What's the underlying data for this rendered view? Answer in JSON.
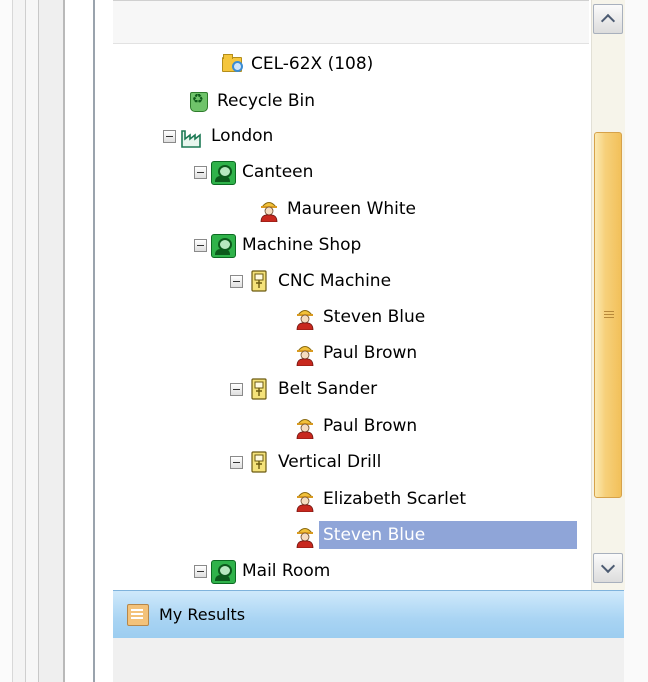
{
  "tree": {
    "nodes": [
      {
        "label": "CEL-62X (108)",
        "icon": "search-folder-icon"
      },
      {
        "label": "Recycle Bin",
        "icon": "recycle-bin-icon"
      },
      {
        "label": "London",
        "icon": "factory-icon"
      },
      {
        "label": "Canteen",
        "icon": "department-icon"
      },
      {
        "label": "Maureen White",
        "icon": "worker-icon"
      },
      {
        "label": "Machine Shop",
        "icon": "department-icon"
      },
      {
        "label": "CNC Machine",
        "icon": "machine-icon"
      },
      {
        "label": "Steven Blue",
        "icon": "worker-icon"
      },
      {
        "label": "Paul Brown",
        "icon": "worker-icon"
      },
      {
        "label": "Belt Sander",
        "icon": "machine-icon"
      },
      {
        "label": "Paul Brown",
        "icon": "worker-icon"
      },
      {
        "label": "Vertical Drill",
        "icon": "machine-icon"
      },
      {
        "label": "Elizabeth Scarlet",
        "icon": "worker-icon"
      },
      {
        "label": "Steven Blue",
        "icon": "worker-icon",
        "selected": true
      },
      {
        "label": "Mail Room",
        "icon": "department-icon"
      }
    ]
  },
  "results_bar": {
    "label": "My Results",
    "icon": "results-icon"
  },
  "colors": {
    "selection": "#8fa5d8",
    "results_bar": "#a9d4f3",
    "scroll_thumb": "#f6d07a"
  }
}
